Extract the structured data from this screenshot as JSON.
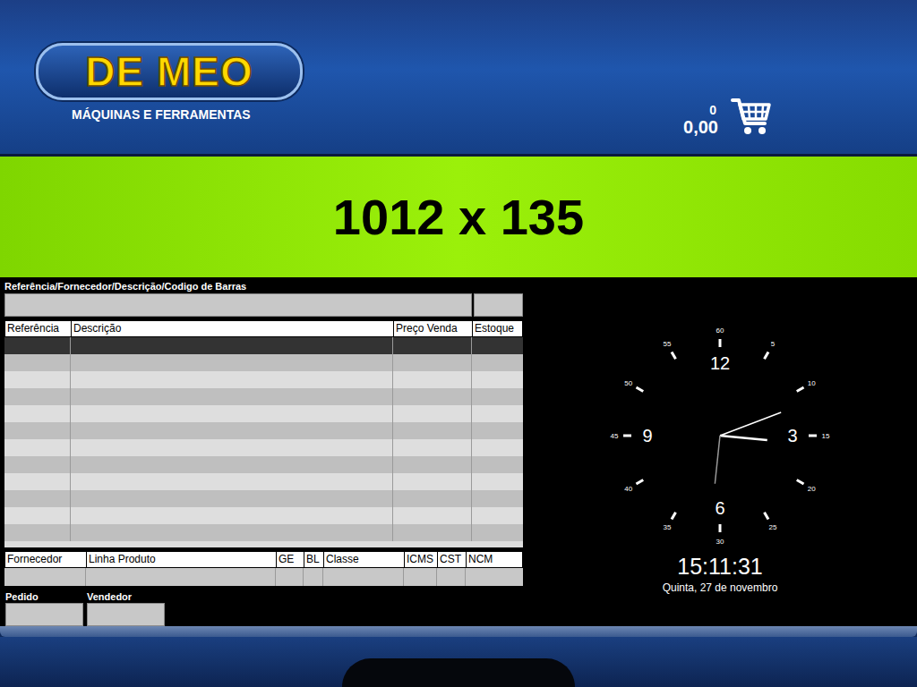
{
  "header": {
    "logo": {
      "title": "DE MEO",
      "subtitle": "MÁQUINAS E FERRAMENTAS"
    },
    "cart": {
      "count": "0",
      "total": "0,00"
    }
  },
  "banner": {
    "label": "1012 x 135"
  },
  "search": {
    "label": "Referência/Fornecedor/Descrição/Codigo de Barras",
    "value": ""
  },
  "products": {
    "columns": [
      "Referência",
      "Descrição",
      "Preço Venda",
      "Estoque"
    ],
    "rows": [
      {
        "selected": true,
        "cells": [
          "",
          "",
          "",
          ""
        ]
      },
      {
        "selected": false,
        "cells": [
          "",
          "",
          "",
          ""
        ]
      },
      {
        "selected": false,
        "cells": [
          "",
          "",
          "",
          ""
        ]
      },
      {
        "selected": false,
        "cells": [
          "",
          "",
          "",
          ""
        ]
      },
      {
        "selected": false,
        "cells": [
          "",
          "",
          "",
          ""
        ]
      },
      {
        "selected": false,
        "cells": [
          "",
          "",
          "",
          ""
        ]
      },
      {
        "selected": false,
        "cells": [
          "",
          "",
          "",
          ""
        ]
      },
      {
        "selected": false,
        "cells": [
          "",
          "",
          "",
          ""
        ]
      },
      {
        "selected": false,
        "cells": [
          "",
          "",
          "",
          ""
        ]
      },
      {
        "selected": false,
        "cells": [
          "",
          "",
          "",
          ""
        ]
      },
      {
        "selected": false,
        "cells": [
          "",
          "",
          "",
          ""
        ]
      },
      {
        "selected": false,
        "cells": [
          "",
          "",
          "",
          ""
        ]
      }
    ]
  },
  "details": {
    "columns": [
      "Fornecedor",
      "Linha Produto",
      "GE",
      "BL",
      "Classe",
      "ICMS",
      "CST",
      "NCM"
    ],
    "values": [
      "",
      "",
      "",
      "",
      "",
      "",
      "",
      ""
    ]
  },
  "order": {
    "fields": [
      {
        "label": "Pedido",
        "value": ""
      },
      {
        "label": "Vendedor",
        "value": ""
      }
    ]
  },
  "clock": {
    "time": "15:11:31",
    "date": "Quinta, 27 de novembro",
    "major": [
      "12",
      "3",
      "6",
      "9"
    ],
    "minor": [
      "60",
      "5",
      "10",
      "15",
      "20",
      "25",
      "30",
      "35",
      "40",
      "45",
      "50",
      "55"
    ]
  }
}
